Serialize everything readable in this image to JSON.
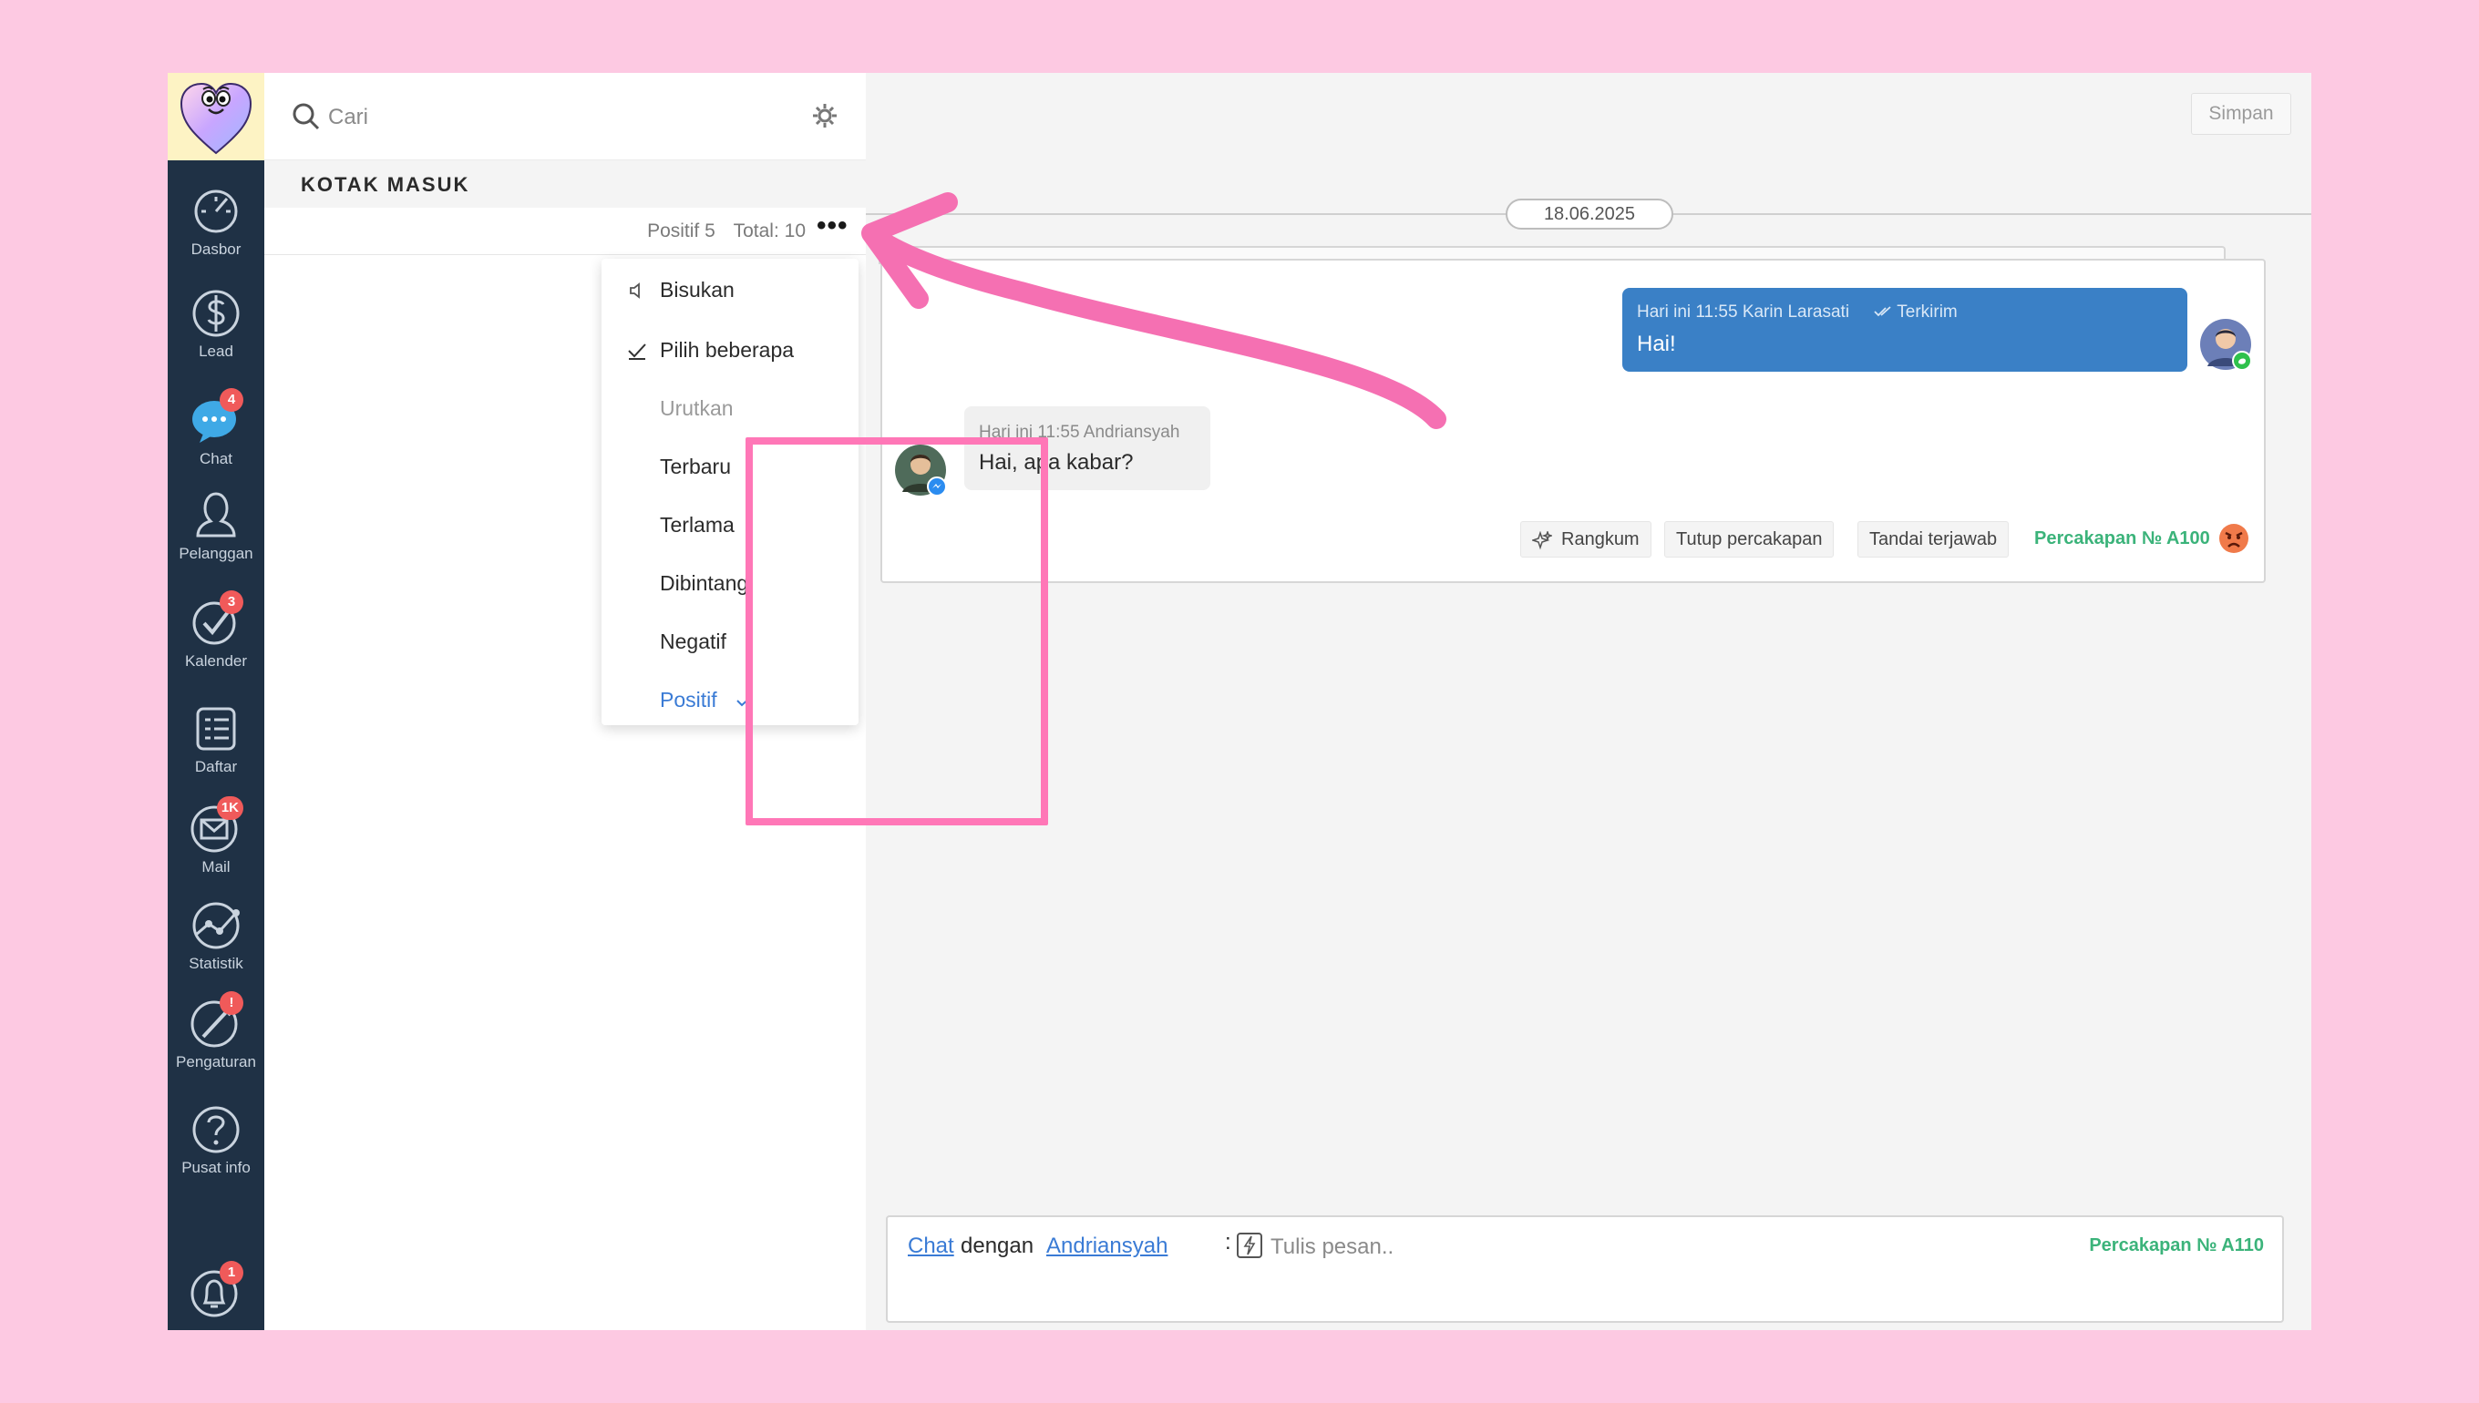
{
  "search": {
    "placeholder": "Cari"
  },
  "inbox": {
    "title": "KOTAK MASUK",
    "filter_label": "Positif 5",
    "total_label": "Total: 10",
    "more_label": "•••"
  },
  "sidebar": {
    "items": [
      {
        "label": "Dasbor",
        "icon": "dashboard-icon"
      },
      {
        "label": "Lead",
        "icon": "dollar-icon"
      },
      {
        "label": "Chat",
        "icon": "chat-icon",
        "badge": "4"
      },
      {
        "label": "Pelanggan",
        "icon": "customers-icon"
      },
      {
        "label": "Kalender",
        "icon": "calendar-check-icon",
        "badge": "3"
      },
      {
        "label": "Daftar",
        "icon": "list-icon"
      },
      {
        "label": "Mail",
        "icon": "mail-icon",
        "badge": "1K"
      },
      {
        "label": "Statistik",
        "icon": "stats-icon"
      },
      {
        "label": "Pengaturan",
        "icon": "settings-icon",
        "badge": "!"
      },
      {
        "label": "Pusat info",
        "icon": "help-icon"
      }
    ],
    "notifications_badge": "1"
  },
  "dropdown": {
    "items": [
      {
        "label": "Bisukan"
      },
      {
        "label": "Pilih beberapa"
      },
      {
        "label": "Urutkan"
      },
      {
        "label": "Terbaru"
      },
      {
        "label": "Terlama"
      },
      {
        "label": "Dibintangi"
      },
      {
        "label": "Negatif"
      },
      {
        "label": "Positif"
      }
    ]
  },
  "chat": {
    "save_label": "Simpan",
    "date": "18.06.2025",
    "outgoing": {
      "meta": "Hari ini 11:55 Karin Larasati",
      "status": "Terkirim",
      "text": "Hai!"
    },
    "incoming": {
      "meta": "Hari ini 11:55 Andriansyah",
      "text": "Hai, apa kabar?"
    },
    "actions": {
      "summarize": "Rangkum",
      "close": "Tutup percakapan",
      "mark_answered": "Tandai terjawab"
    },
    "conversation_number": "Percakapan № A100"
  },
  "composer": {
    "channel": "Chat",
    "with": "dengan",
    "contact": "Andriansyah",
    "colon": ":",
    "placeholder": "Tulis pesan..",
    "conversation_number": "Percakapan № A110"
  },
  "colors": {
    "accent": "#3a80c6",
    "sidebar": "#1f3145",
    "highlight": "#ff77b7",
    "success": "#3bb37a",
    "badge": "#f05a5a"
  }
}
